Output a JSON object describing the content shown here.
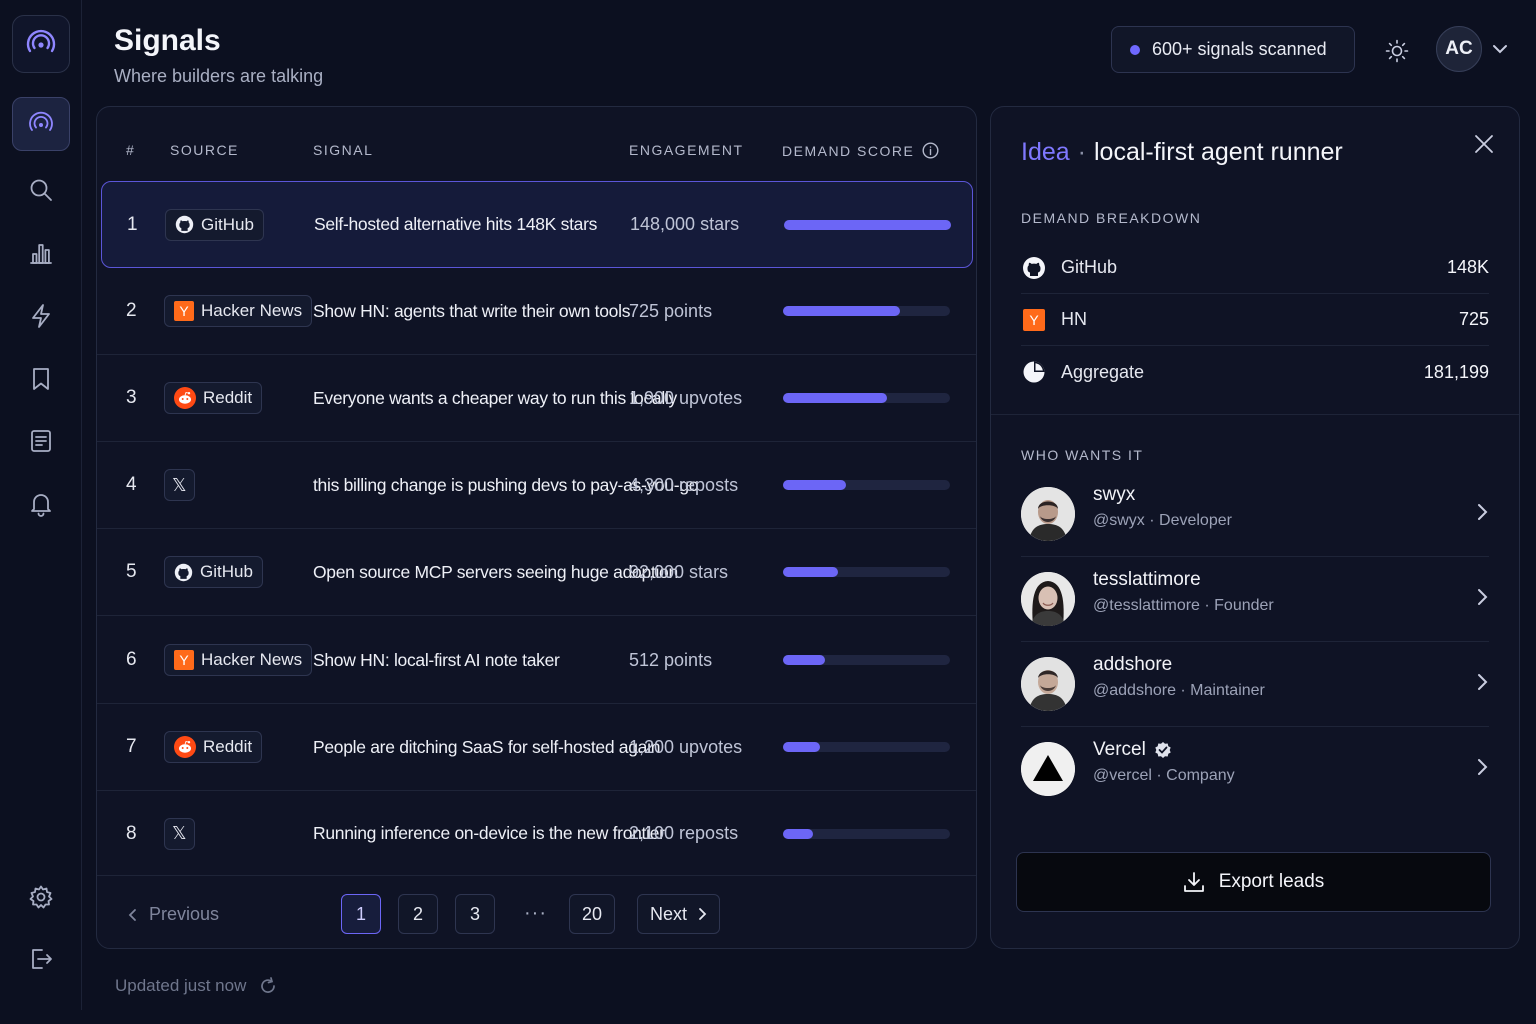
{
  "header": {
    "title": "Signals",
    "subtitle": "Where builders are talking",
    "signals_count": "600+ signals scanned",
    "avatar_initials": "AC"
  },
  "nav": [
    "signals",
    "search",
    "analytics",
    "bolt",
    "bookmark",
    "notes",
    "alerts",
    "settings",
    "logout"
  ],
  "table": {
    "headers": {
      "index": "#",
      "source": "SOURCE",
      "signal": "SIGNAL",
      "engagement": "ENGAGEMENT",
      "demand": "DEMAND SCORE"
    },
    "rows": [
      {
        "n": "1",
        "source": "GitHub",
        "source_type": "github",
        "signal": "Self-hosted alternative hits 148K stars",
        "engagement": "148,000 stars",
        "score": 1.0
      },
      {
        "n": "2",
        "source": "Hacker News",
        "source_type": "hn",
        "signal": "Show HN: agents that write their own tools",
        "engagement": "725 points",
        "score": 0.7
      },
      {
        "n": "3",
        "source": "Reddit",
        "source_type": "reddit",
        "signal": "Everyone wants a cheaper way to run this locally",
        "engagement": "1,900 upvotes",
        "score": 0.62
      },
      {
        "n": "4",
        "source": "",
        "source_type": "x",
        "signal": "this billing change is pushing devs to pay-as-you-go",
        "engagement": "4,300 reposts",
        "score": 0.38
      },
      {
        "n": "5",
        "source": "GitHub",
        "source_type": "github",
        "signal": "Open source MCP servers seeing huge adoption",
        "engagement": "92,000 stars",
        "score": 0.33
      },
      {
        "n": "6",
        "source": "Hacker News",
        "source_type": "hn",
        "signal": "Show HN: local-first AI note taker",
        "engagement": "512 points",
        "score": 0.25
      },
      {
        "n": "7",
        "source": "Reddit",
        "source_type": "reddit",
        "signal": "People are ditching SaaS for self-hosted again",
        "engagement": "1,200 upvotes",
        "score": 0.22
      },
      {
        "n": "8",
        "source": "",
        "source_type": "x",
        "signal": "Running inference on-device is the new frontier",
        "engagement": "2,100 reposts",
        "score": 0.18
      }
    ]
  },
  "pagination": {
    "previous": "Previous",
    "next": "Next",
    "pages": [
      "1",
      "2",
      "3",
      "20"
    ],
    "ellipsis": "···",
    "current": "1"
  },
  "updated": "Updated just now",
  "detail": {
    "idea_label": "Idea",
    "separator": "·",
    "idea_name": "local-first agent runner",
    "breakdown_label": "DEMAND BREAKDOWN",
    "breakdown": [
      {
        "label": "GitHub",
        "value": "148K",
        "icon": "github-icon"
      },
      {
        "label": "HN",
        "value": "725",
        "icon": "hn-icon"
      },
      {
        "label": "Aggregate",
        "value": "181,199",
        "icon": "pie-chart-icon"
      }
    ],
    "who_label": "WHO WANTS IT",
    "people": [
      {
        "name": "swyx",
        "sub": "@swyx · Developer",
        "verified": false
      },
      {
        "name": "tesslattimore",
        "sub": "@tesslattimore · Founder",
        "verified": false
      },
      {
        "name": "addshore",
        "sub": "@addshore · Maintainer",
        "verified": false
      },
      {
        "name": "Vercel",
        "sub": "@vercel · Company",
        "verified": true
      }
    ],
    "export_label": "Export leads"
  },
  "colors": {
    "accent": "#6c66f6",
    "background": "#0c1020",
    "panel": "#0f1325",
    "hn": "#ff6a1a",
    "reddit": "#ff4a14"
  }
}
